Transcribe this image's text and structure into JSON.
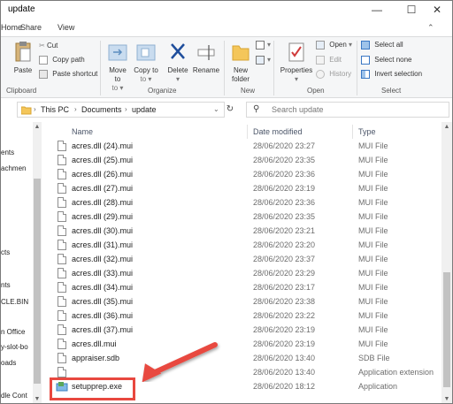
{
  "window": {
    "title": "update",
    "minimize": "—",
    "maximize": "☐",
    "close": "✕"
  },
  "ribbon_tabs": {
    "home": "Home",
    "share": "Share",
    "view": "View"
  },
  "ribbon": {
    "clipboard": {
      "paste": "Paste",
      "cut": "Cut",
      "copy_path": "Copy path",
      "paste_shortcut": "Paste shortcut",
      "group": "Clipboard"
    },
    "organize": {
      "move_to": "Move to",
      "copy_to": "Copy to",
      "delete": "Delete",
      "rename": "Rename",
      "group": "Organize"
    },
    "new": {
      "new_folder": "New folder",
      "group": "New"
    },
    "open": {
      "properties": "Properties",
      "open": "Open",
      "edit": "Edit",
      "history": "History",
      "group": "Open"
    },
    "select": {
      "select_all": "Select all",
      "select_none": "Select none",
      "invert_selection": "Invert selection",
      "group": "Select"
    }
  },
  "address": {
    "crumbs": [
      "This PC",
      "Documents",
      "update"
    ],
    "search_placeholder": "Search update"
  },
  "nav_items": [
    "ents",
    "achmen",
    "cts",
    "nts",
    "CLE.BIN",
    "n Office",
    "y-slot-bo",
    "oads",
    "dle Cont"
  ],
  "columns": {
    "name": "Name",
    "date": "Date modified",
    "type": "Type"
  },
  "files": [
    {
      "name": "acres.dll (24).mui",
      "date": "28/06/2020 23:27",
      "type": "MUI File"
    },
    {
      "name": "acres.dll (25).mui",
      "date": "28/06/2020 23:35",
      "type": "MUI File"
    },
    {
      "name": "acres.dll (26).mui",
      "date": "28/06/2020 23:36",
      "type": "MUI File"
    },
    {
      "name": "acres.dll (27).mui",
      "date": "28/06/2020 23:19",
      "type": "MUI File"
    },
    {
      "name": "acres.dll (28).mui",
      "date": "28/06/2020 23:36",
      "type": "MUI File"
    },
    {
      "name": "acres.dll (29).mui",
      "date": "28/06/2020 23:35",
      "type": "MUI File"
    },
    {
      "name": "acres.dll (30).mui",
      "date": "28/06/2020 23:21",
      "type": "MUI File"
    },
    {
      "name": "acres.dll (31).mui",
      "date": "28/06/2020 23:20",
      "type": "MUI File"
    },
    {
      "name": "acres.dll (32).mui",
      "date": "28/06/2020 23:37",
      "type": "MUI File"
    },
    {
      "name": "acres.dll (33).mui",
      "date": "28/06/2020 23:29",
      "type": "MUI File"
    },
    {
      "name": "acres.dll (34).mui",
      "date": "28/06/2020 23:17",
      "type": "MUI File"
    },
    {
      "name": "acres.dll (35).mui",
      "date": "28/06/2020 23:38",
      "type": "MUI File"
    },
    {
      "name": "acres.dll (36).mui",
      "date": "28/06/2020 23:22",
      "type": "MUI File"
    },
    {
      "name": "acres.dll (37).mui",
      "date": "28/06/2020 23:19",
      "type": "MUI File"
    },
    {
      "name": "acres.dll.mui",
      "date": "28/06/2020 23:19",
      "type": "MUI File"
    },
    {
      "name": "appraiser.sdb",
      "date": "28/06/2020 13:40",
      "type": "SDB File"
    },
    {
      "name": "",
      "date": "28/06/2020 13:40",
      "type": "Application extension"
    },
    {
      "name": "setupprep.exe",
      "date": "28/06/2020 18:12",
      "type": "Application"
    }
  ],
  "colors": {
    "highlight": "#e8483f",
    "accent": "#1a73c8"
  }
}
